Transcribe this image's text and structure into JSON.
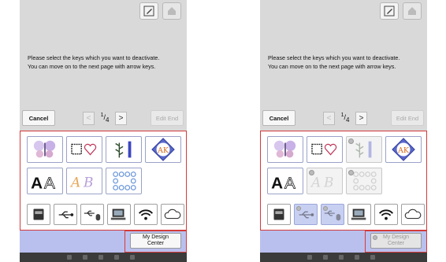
{
  "screen": {
    "message_line1": "Please select the keys which you want to deactivate.",
    "message_line2": "You can move on to the next page with arrow keys.",
    "cancel_label": "Cancel",
    "edit_end_label": "Edit End",
    "page_current": "1",
    "page_total": "4",
    "prev_arrow": "<",
    "next_arrow": ">",
    "design_center_line1": "My Design",
    "design_center_line2": "Center"
  },
  "keys": [
    {
      "name": "embroidery-butterfly-key",
      "icon": "butterfly-design-icon"
    },
    {
      "name": "frame-heart-key",
      "icon": "frame-heart-icon"
    },
    {
      "name": "floral-border-key",
      "icon": "floral-border-icon"
    },
    {
      "name": "monogram-key",
      "icon": "monogram-icon"
    },
    {
      "name": "alphabet-key",
      "icon": "alphabet-icon"
    },
    {
      "name": "script-letters-key",
      "icon": "script-letters-icon"
    },
    {
      "name": "quilt-frame-key",
      "icon": "quilt-frame-icon"
    }
  ],
  "interface_keys": [
    {
      "name": "machine-memory-key",
      "icon": "machine-icon"
    },
    {
      "name": "usb-key-1",
      "icon": "usb-icon"
    },
    {
      "name": "usb-key-2",
      "icon": "usb-mouse-icon"
    },
    {
      "name": "computer-key",
      "icon": "computer-icon"
    },
    {
      "name": "wireless-key",
      "icon": "wifi-icon"
    },
    {
      "name": "cloud-key",
      "icon": "cloud-icon"
    }
  ],
  "colors": {
    "selection_frame": "#d43a3a",
    "deactivated_key": "#c8d0f2",
    "bottom_band": "#b9c0ee"
  }
}
